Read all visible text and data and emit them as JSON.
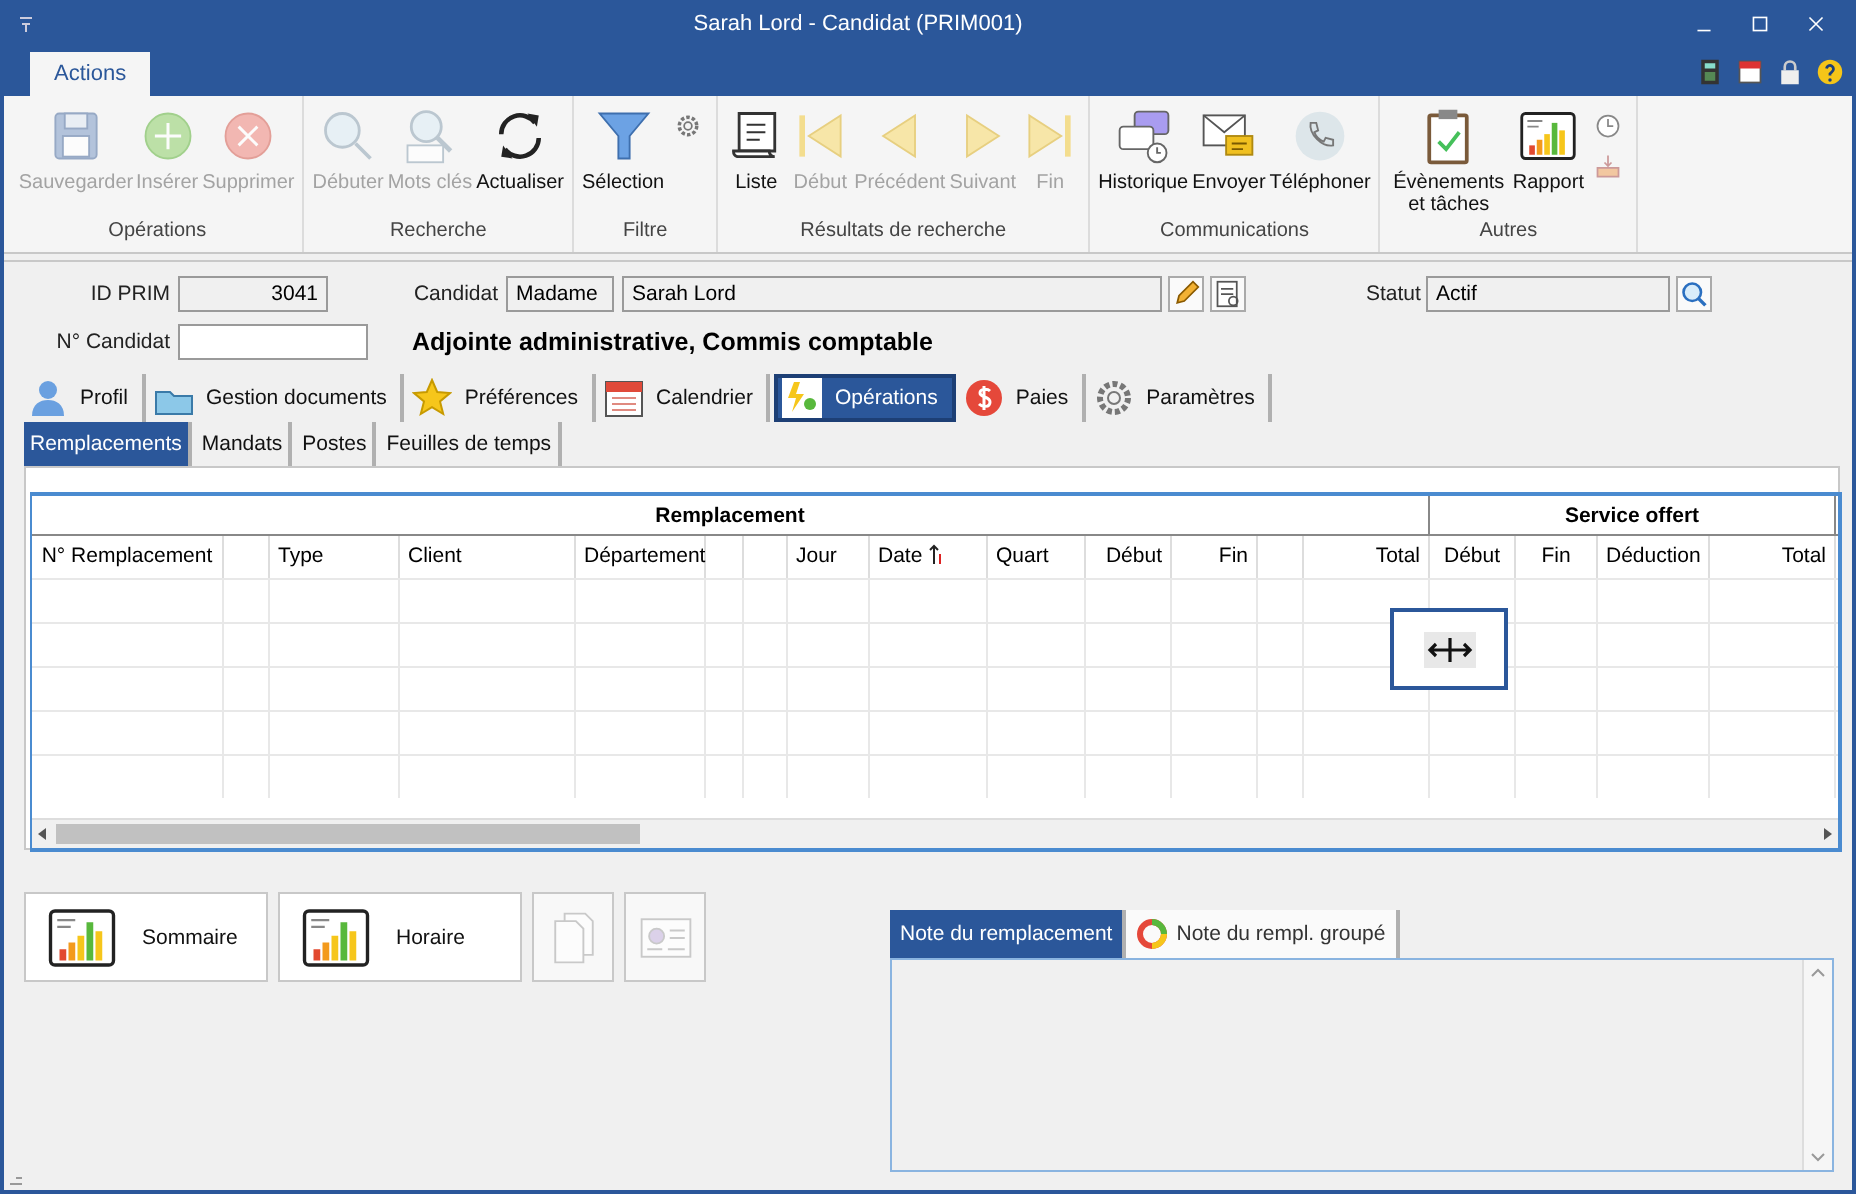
{
  "window": {
    "title": "Sarah Lord - Candidat (PRIM001)"
  },
  "ribbon": {
    "tabs": [
      {
        "label": "Actions",
        "selected": true
      }
    ],
    "groups": [
      {
        "label": "Opérations",
        "buttons": [
          {
            "label": "Sauvegarder",
            "disabled": true
          },
          {
            "label": "Insérer",
            "disabled": true
          },
          {
            "label": "Supprimer",
            "disabled": true
          }
        ]
      },
      {
        "label": "Recherche",
        "buttons": [
          {
            "label": "Débuter",
            "disabled": true
          },
          {
            "label": "Mots clés",
            "disabled": true
          },
          {
            "label": "Actualiser",
            "disabled": false
          }
        ]
      },
      {
        "label": "Filtre",
        "buttons": [
          {
            "label": "Sélection",
            "disabled": false
          }
        ]
      },
      {
        "label": "Résultats de recherche",
        "buttons": [
          {
            "label": "Liste",
            "disabled": false
          },
          {
            "label": "Début",
            "disabled": true
          },
          {
            "label": "Précédent",
            "disabled": true
          },
          {
            "label": "Suivant",
            "disabled": true
          },
          {
            "label": "Fin",
            "disabled": true
          }
        ]
      },
      {
        "label": "Communications",
        "buttons": [
          {
            "label": "Historique",
            "disabled": false
          },
          {
            "label": "Envoyer",
            "disabled": false
          },
          {
            "label": "Téléphoner",
            "disabled": false
          }
        ]
      },
      {
        "label": "Autres",
        "buttons": [
          {
            "label": "Évènements et tâches",
            "disabled": false
          },
          {
            "label": "Rapport",
            "disabled": false
          }
        ]
      }
    ]
  },
  "form": {
    "id_label": "ID PRIM",
    "id_value": "3041",
    "candidate_label": "Candidat",
    "salutation": "Madame",
    "name": "Sarah Lord",
    "status_label": "Statut",
    "status": "Actif",
    "number_label": "N° Candidat",
    "job_title": "Adjointe administrative, Commis comptable"
  },
  "tabs": [
    {
      "label": "Profil",
      "selected": false
    },
    {
      "label": "Gestion documents",
      "selected": false
    },
    {
      "label": "Préférences",
      "selected": false
    },
    {
      "label": "Calendrier",
      "selected": false
    },
    {
      "label": "Opérations",
      "selected": true
    },
    {
      "label": "Paies",
      "selected": false
    },
    {
      "label": "Paramètres",
      "selected": false
    }
  ],
  "subtabs": [
    {
      "label": "Remplacements",
      "selected": true
    },
    {
      "label": "Mandats",
      "selected": false
    },
    {
      "label": "Postes",
      "selected": false
    },
    {
      "label": "Feuilles de temps",
      "selected": false
    }
  ],
  "table": {
    "groups": [
      {
        "label": "Remplacement",
        "columns": [
          {
            "kind": "text",
            "label": "N° Remplacement"
          },
          {
            "kind": "spacer"
          },
          {
            "kind": "text",
            "label": "Type"
          },
          {
            "kind": "text",
            "label": "Client"
          },
          {
            "kind": "text",
            "label": "Département"
          },
          {
            "kind": "spacer"
          },
          {
            "kind": "spacer"
          },
          {
            "kind": "text",
            "label": "Jour"
          },
          {
            "kind": "text",
            "label": "Date",
            "sorted": true
          },
          {
            "kind": "text",
            "label": "Quart"
          },
          {
            "kind": "text",
            "label": "Début"
          },
          {
            "kind": "text",
            "label": "Fin"
          },
          {
            "kind": "spacer"
          },
          {
            "kind": "text",
            "label": "Total"
          }
        ]
      },
      {
        "label": "Service offert",
        "columns": [
          {
            "kind": "text",
            "label": "Début"
          },
          {
            "kind": "text",
            "label": "Fin"
          },
          {
            "kind": "text",
            "label": "Déduction"
          },
          {
            "kind": "text",
            "label": "Total"
          }
        ]
      }
    ]
  },
  "bottom_buttons": [
    {
      "kind": "text",
      "label": "Sommaire",
      "disabled": false
    },
    {
      "kind": "text",
      "label": "Horaire",
      "disabled": false
    },
    {
      "kind": "icon",
      "disabled": true
    },
    {
      "kind": "icon",
      "disabled": true
    }
  ],
  "note_tabs": [
    {
      "label": "Note du remplacement",
      "selected": true
    },
    {
      "label": "Note du rempl. groupé",
      "selected": false
    }
  ]
}
